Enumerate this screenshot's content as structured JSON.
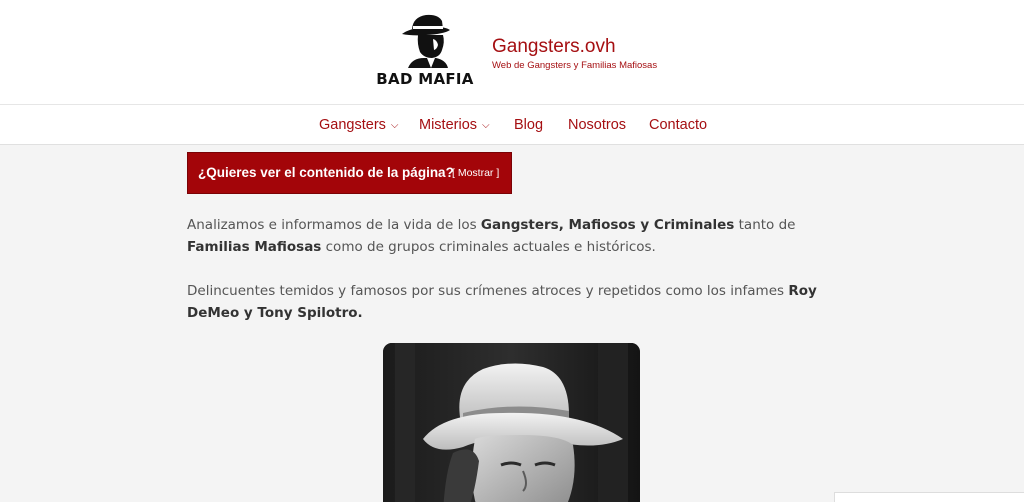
{
  "header": {
    "logo_text": "BAD MAFIA",
    "logo_icon": "gangster-silhouette-icon",
    "site_title": "Gangsters.ovh",
    "site_description": "Web de Gangsters y Familias Mafiosas"
  },
  "nav": {
    "items": [
      {
        "label": "Gangsters",
        "has_dropdown": true
      },
      {
        "label": "Misterios",
        "has_dropdown": true
      },
      {
        "label": "Blog",
        "has_dropdown": false
      },
      {
        "label": "Nosotros",
        "has_dropdown": false
      },
      {
        "label": "Contacto",
        "has_dropdown": false
      }
    ],
    "dropdown_icon": "chevron-down-icon"
  },
  "spoiler": {
    "question": "¿Quieres ver el contenido de la página?",
    "button_label": "[ Mostrar ]"
  },
  "content": {
    "p1_a": "Analizamos e informamos de la vida de los ",
    "p1_b": "Gangsters, Mafiosos y Criminales",
    "p1_c": " tanto de ",
    "p1_d": "Familias Mafiosas",
    "p1_e": " como de grupos criminales actuales e históricos.",
    "p2_a": "Delincuentes temidos y famosos por sus crímenes atroces y repetidos como los infames ",
    "p2_b": "Roy DeMeo y Tony Spilotro."
  },
  "colors": {
    "brand_red": "#a50f12",
    "spoiler_bg": "#a30509",
    "page_bg": "#f4f4f4"
  }
}
